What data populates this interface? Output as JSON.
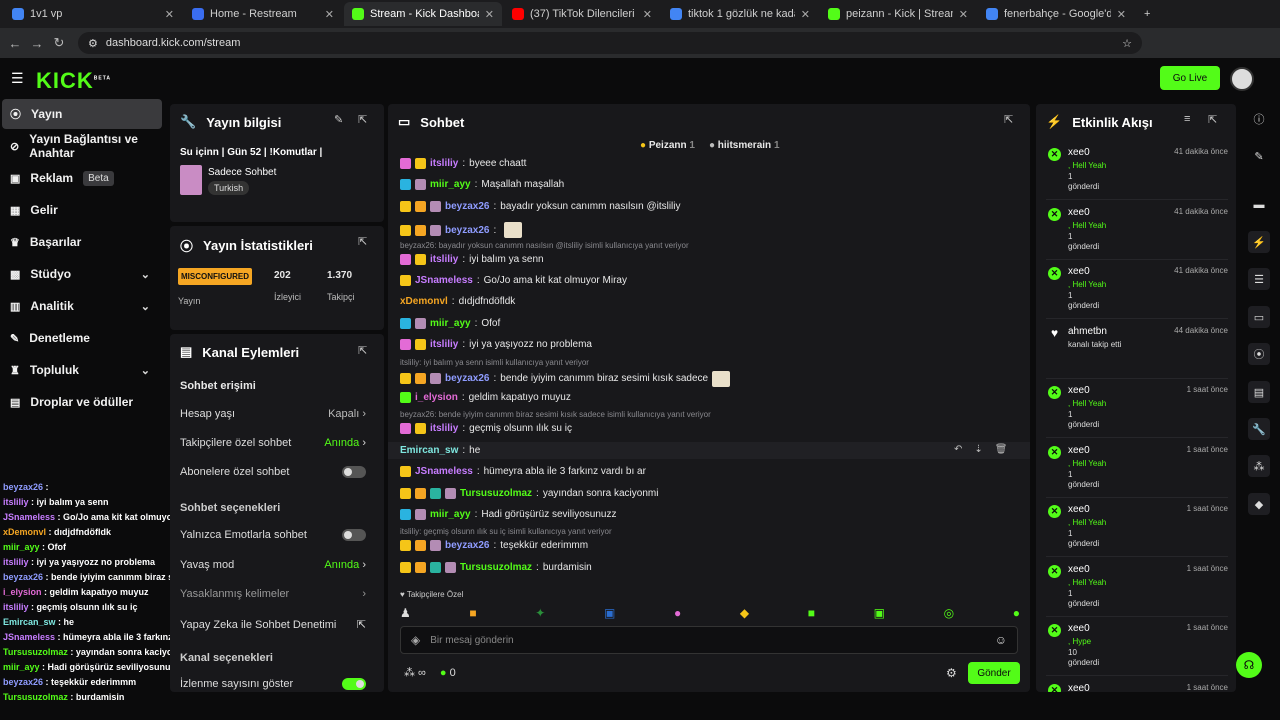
{
  "tabs": [
    {
      "title": "1v1 vp",
      "color": "#4285f4"
    },
    {
      "title": "Home - Restream",
      "color": "#3a6df0"
    },
    {
      "title": "Stream - Kick Dashboard",
      "color": "#53fc18"
    },
    {
      "title": "(37) TikTok Dilencileri 2 !! - You",
      "color": "#ff0000"
    },
    {
      "title": "tiktok 1 gözlük ne kadar - Goog",
      "color": "#4285f4"
    },
    {
      "title": "peizann - Kick | StreamerStats",
      "color": "#53fc18"
    },
    {
      "title": "fenerbahçe - Google'da Ara",
      "color": "#4285f4"
    }
  ],
  "url": "dashboard.kick.com/stream",
  "logo": "KICK",
  "logo_beta": "BETA",
  "go_live": "Go Live",
  "sidebar": [
    {
      "label": "Yayın",
      "icon": "broadcast-icon",
      "active": true
    },
    {
      "label": "Yayın Bağlantısı ve Anahtar",
      "icon": "link-icon"
    },
    {
      "label": "Reklam",
      "icon": "ad-icon",
      "badge": "Beta"
    },
    {
      "label": "Gelir",
      "icon": "revenue-icon"
    },
    {
      "label": "Başarılar",
      "icon": "trophy-icon"
    },
    {
      "label": "Stüdyo",
      "icon": "studio-icon",
      "chevron": true
    },
    {
      "label": "Analitik",
      "icon": "analytics-icon",
      "chevron": true
    },
    {
      "label": "Denetleme",
      "icon": "moderation-icon"
    },
    {
      "label": "Topluluk",
      "icon": "community-icon",
      "chevron": true
    },
    {
      "label": "Droplar ve ödüller",
      "icon": "gift-icon"
    }
  ],
  "stream_info": {
    "title": "Yayın bilgisi",
    "stream_title": "Su içinn | Gün 52 | !Komutlar |",
    "category": "Sadece Sohbet",
    "language": "Turkish"
  },
  "stats": {
    "title": "Yayın İstatistikleri",
    "status": "MISCONFIGURED",
    "status_label": "Yayın",
    "viewers": "202",
    "viewers_label": "İzleyici",
    "followers": "1.370",
    "followers_label": "Takipçi"
  },
  "channel_actions": {
    "title": "Kanal Eylemleri",
    "chat_access": "Sohbet erişimi",
    "account_age": "Hesap yaşı",
    "account_age_value": "Kapalı",
    "followers_only": "Takipçilere özel sohbet",
    "followers_only_value": "Anında",
    "subscribers_only": "Abonelere özel sohbet",
    "chat_options": "Sohbet seçenekleri",
    "emotes_only": "Yalnızca Emotlarla sohbet",
    "slow_mode": "Yavaş mod",
    "slow_mode_value": "Anında",
    "blocked_words": "Yasaklanmış kelimeler",
    "ai_moderation": "Yapay Zeka ile Sohbet Denetimi",
    "channel_options": "Kanal seçenekleri",
    "show_view_count": "İzlenme sayısını göster"
  },
  "chat": {
    "title": "Sohbet",
    "pinned_users": [
      {
        "name": "Peizann",
        "count": "1"
      },
      {
        "name": "hiitsmerain",
        "count": "1"
      }
    ],
    "messages": [
      {
        "user": "itsliliy",
        "text": "byeee chaatt",
        "color": "#c77dff",
        "badges": [
          "#e36bd6",
          "#f5c518"
        ]
      },
      {
        "user": "miir_ayy",
        "text": "Maşallah maşallah",
        "color": "#53fc18",
        "badges": [
          "#2ab3e0",
          "#b38cb4"
        ]
      },
      {
        "user": "beyzax26",
        "text": "bayadır yoksun canımm nasılsın @itsliliy",
        "color": "#8f9cff",
        "badges": [
          "#f5c518",
          "#f5a623",
          "#b38cb4"
        ]
      },
      {
        "user": "beyzax26",
        "text": "",
        "color": "#8f9cff",
        "badges": [
          "#f5c518",
          "#f5a623",
          "#b38cb4"
        ],
        "emote": true
      },
      {
        "reply": "beyzax26: bayadır yoksun canımm nasılsın @itsliliy isimli kullanıcıya yanıt veriyor"
      },
      {
        "user": "itsliliy",
        "text": "iyi balım ya senn",
        "color": "#c77dff",
        "badges": [
          "#e36bd6",
          "#f5c518"
        ]
      },
      {
        "user": "JSnameless",
        "text": "Go/Jo ama kit kat olmuyor Miray",
        "color": "#c77dff",
        "badges": [
          "#f5c518"
        ]
      },
      {
        "user": "xDemonvl",
        "text": "dıdjdfndöfldk",
        "color": "#f5a623",
        "badges": []
      },
      {
        "user": "miir_ayy",
        "text": "Ofof",
        "color": "#53fc18",
        "badges": [
          "#2ab3e0",
          "#b38cb4"
        ]
      },
      {
        "user": "itsliliy",
        "text": "iyi ya yaşıyozz no problema",
        "color": "#c77dff",
        "badges": [
          "#e36bd6",
          "#f5c518"
        ]
      },
      {
        "reply": "itsliliy: iyi balım ya senn isimli kullanıcıya yanıt veriyor"
      },
      {
        "user": "beyzax26",
        "text": "bende iyiyim canımm biraz sesimi kısık sadece",
        "color": "#8f9cff",
        "badges": [
          "#f5c518",
          "#f5a623",
          "#b38cb4"
        ],
        "emote": true
      },
      {
        "user": "i_elysion",
        "text": "geldim kapatıyo muyuz",
        "color": "#e36bd6",
        "badges": [
          "#53fc18"
        ]
      },
      {
        "reply": "beyzax26: bende iyiyim canımm biraz sesimi kısık sadece isimli kullanıcıya yanıt veriyor"
      },
      {
        "user": "itsliliy",
        "text": "geçmiş olsunn ılık su iç",
        "color": "#c77dff",
        "badges": [
          "#e36bd6",
          "#f5c518"
        ]
      },
      {
        "user": "Emircan_sw",
        "text": "he",
        "color": "#7fe7e0",
        "badges": []
      },
      {
        "user": "JSnameless",
        "text": "hümeyra abla ile 3 farkınz vardı bı ar",
        "color": "#c77dff",
        "badges": [
          "#f5c518"
        ]
      },
      {
        "user": "Tursusuzolmaz",
        "text": "yayından sonra kaciyonmi",
        "color": "#53fc18",
        "badges": [
          "#f5c518",
          "#f5a623",
          "#2ab3a0",
          "#b38cb4"
        ]
      },
      {
        "user": "miir_ayy",
        "text": "Hadi görüşürüz seviliyosunuzz",
        "color": "#53fc18",
        "badges": [
          "#2ab3e0",
          "#b38cb4"
        ]
      },
      {
        "reply": "itsliliy: geçmiş olsunn ılık su iç isimli kullanıcıya yanıt veriyor"
      },
      {
        "user": "beyzax26",
        "text": "teşekkür ederimmm",
        "color": "#8f9cff",
        "badges": [
          "#f5c518",
          "#f5a623",
          "#b38cb4"
        ]
      },
      {
        "user": "Tursusuzolmaz",
        "text": "burdamisin",
        "color": "#53fc18",
        "badges": [
          "#f5c518",
          "#f5a623",
          "#2ab3a0",
          "#b38cb4"
        ]
      }
    ],
    "followers_only_label": "Takipçilere Özel",
    "placeholder": "Bir mesaj gönderin",
    "points": "0",
    "send": "Gönder"
  },
  "activity": {
    "title": "Etkinlik Akışı",
    "events": [
      {
        "user": "xee0",
        "time": "41 dakika önce",
        "gift": ", Hell Yeah",
        "amount": "1",
        "action": "gönderdi"
      },
      {
        "user": "xee0",
        "time": "41 dakika önce",
        "gift": ", Hell Yeah",
        "amount": "1",
        "action": "gönderdi"
      },
      {
        "user": "xee0",
        "time": "41 dakika önce",
        "gift": ", Hell Yeah",
        "amount": "1",
        "action": "gönderdi"
      },
      {
        "user": "ahmetbn",
        "time": "44 dakika önce",
        "gift": "",
        "amount": "",
        "action": "kanalı takip etti",
        "follow": true
      },
      {
        "user": "xee0",
        "time": "1 saat önce",
        "gift": ", Hell Yeah",
        "amount": "1",
        "action": "gönderdi"
      },
      {
        "user": "xee0",
        "time": "1 saat önce",
        "gift": ", Hell Yeah",
        "amount": "1",
        "action": "gönderdi"
      },
      {
        "user": "xee0",
        "time": "1 saat önce",
        "gift": ", Hell Yeah",
        "amount": "1",
        "action": "gönderdi"
      },
      {
        "user": "xee0",
        "time": "1 saat önce",
        "gift": ", Hell Yeah",
        "amount": "1",
        "action": "gönderdi"
      },
      {
        "user": "xee0",
        "time": "1 saat önce",
        "gift": ", Hype",
        "amount": "10",
        "action": "gönderdi"
      },
      {
        "user": "xee0",
        "time": "1 saat önce",
        "gift": ", Hype",
        "amount": "10",
        "action": "gönderdi"
      }
    ]
  },
  "overlay": [
    {
      "u": "beyzax26",
      "t": "",
      "c": "#8f9cff"
    },
    {
      "u": "itsliliy",
      "t": "iyi balım ya senn",
      "c": "#c77dff"
    },
    {
      "u": "JSnameless",
      "t": "Go/Jo ama kit kat olmuyor Miray",
      "c": "#c77dff"
    },
    {
      "u": "xDemonvl",
      "t": "dıdjdfndöfldk",
      "c": "#f5a623"
    },
    {
      "u": "miir_ayy",
      "t": "Ofof",
      "c": "#53fc18"
    },
    {
      "u": "itsliliy",
      "t": "iyi ya yaşıyozz no problema",
      "c": "#c77dff"
    },
    {
      "u": "beyzax26",
      "t": "bende iyiyim canımm biraz sesimi kısık sadece",
      "c": "#8f9cff"
    },
    {
      "u": "i_elysion",
      "t": "geldim kapatıyo muyuz",
      "c": "#e36bd6"
    },
    {
      "u": "itsliliy",
      "t": "geçmiş olsunn ılık su iç",
      "c": "#c77dff"
    },
    {
      "u": "Emircan_sw",
      "t": "he",
      "c": "#7fe7e0"
    },
    {
      "u": "JSnameless",
      "t": "hümeyra abla ile 3 farkınz vardı bı ar",
      "c": "#c77dff"
    },
    {
      "u": "Tursusuzolmaz",
      "t": "yayından sonra kaciyonmi",
      "c": "#53fc18"
    },
    {
      "u": "miir_ayy",
      "t": "Hadi görüşürüz seviliyosunuzz",
      "c": "#53fc18"
    },
    {
      "u": "beyzax26",
      "t": "teşekkür ederimmm",
      "c": "#8f9cff"
    },
    {
      "u": "Tursusuzolmaz",
      "t": "burdamisin",
      "c": "#53fc18"
    }
  ]
}
